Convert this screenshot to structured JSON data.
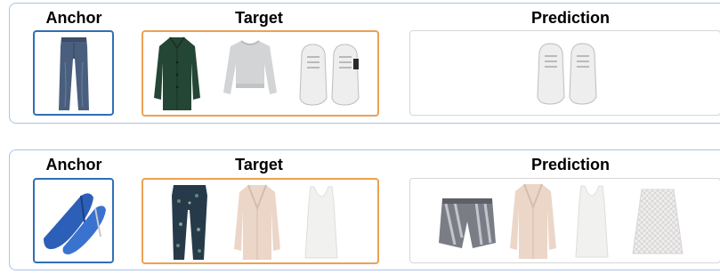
{
  "rows": [
    {
      "anchor_label": "Anchor",
      "target_label": "Target",
      "prediction_label": "Prediction",
      "anchor": [
        "jeans"
      ],
      "target": [
        "green-coat",
        "grey-sweater",
        "white-sneakers"
      ],
      "prediction": [
        "white-sneakers"
      ]
    },
    {
      "anchor_label": "Anchor",
      "target_label": "Target",
      "prediction_label": "Prediction",
      "anchor": [
        "blue-heels"
      ],
      "target": [
        "printed-trousers",
        "pink-coat",
        "white-tank-top"
      ],
      "prediction": [
        "striped-shorts",
        "pink-coat",
        "white-tank-top",
        "white-skirt"
      ]
    }
  ],
  "colors": {
    "panel_border": "#a9c3e8",
    "anchor_border": "#2f6fb5",
    "target_border": "#eca152",
    "prediction_border": "#d6d6d6"
  }
}
